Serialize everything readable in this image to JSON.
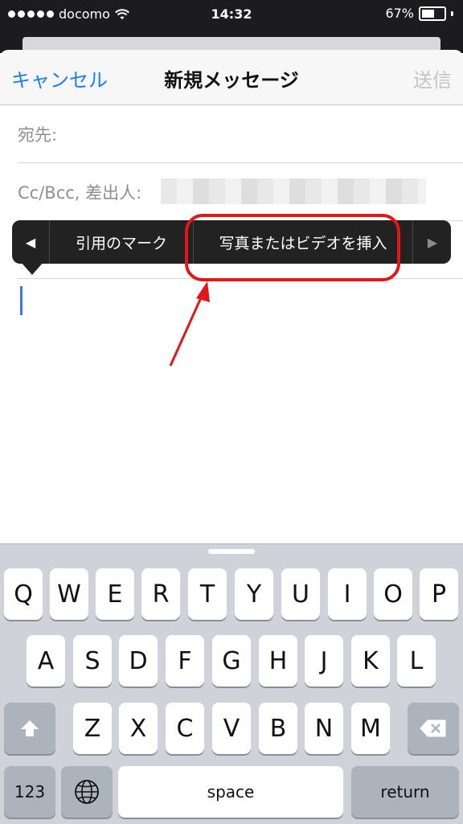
{
  "status_bar": {
    "carrier": "docomo",
    "time": "14:32",
    "battery_percent": "67%",
    "battery_level": 0.67,
    "signal_icon": "signal-dots-icon",
    "wifi_icon": "wifi-icon"
  },
  "nav": {
    "cancel": "キャンセル",
    "title": "新規メッセージ",
    "send": "送信"
  },
  "fields": {
    "to_label": "宛先:",
    "cc_label": "Cc/Bcc, 差出人:"
  },
  "callout": {
    "left_arrow": "◀",
    "item1": "引用のマーク",
    "item2": "写真またはビデオを挿入",
    "right_arrow": "▶"
  },
  "annotation": {
    "highlight_color": "#e3161a"
  },
  "keyboard": {
    "row1": [
      "Q",
      "W",
      "E",
      "R",
      "T",
      "Y",
      "U",
      "I",
      "O",
      "P"
    ],
    "row2": [
      "A",
      "S",
      "D",
      "F",
      "G",
      "H",
      "J",
      "K",
      "L"
    ],
    "row3": [
      "Z",
      "X",
      "C",
      "V",
      "B",
      "N",
      "M"
    ],
    "numbers_label": "123",
    "space_label": "space",
    "return_label": "return",
    "shift_icon": "shift-icon",
    "delete_icon": "delete-icon",
    "globe_icon": "globe-icon"
  }
}
